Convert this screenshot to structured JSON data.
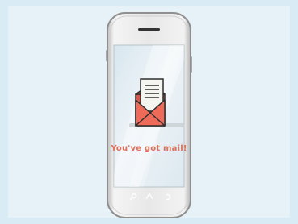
{
  "screen": {
    "message": "You've got mail!"
  },
  "colors": {
    "background": "#d9ebf5",
    "phone_body": "#e9e9e9",
    "screen_tint": "#e6eff4",
    "envelope": "#ee6b5a",
    "letter": "#f4f4f0",
    "message_text": "#e06f5a"
  },
  "icons": {
    "main": "envelope-open-icon",
    "nav": [
      "search-icon",
      "home-icon",
      "back-icon"
    ]
  }
}
